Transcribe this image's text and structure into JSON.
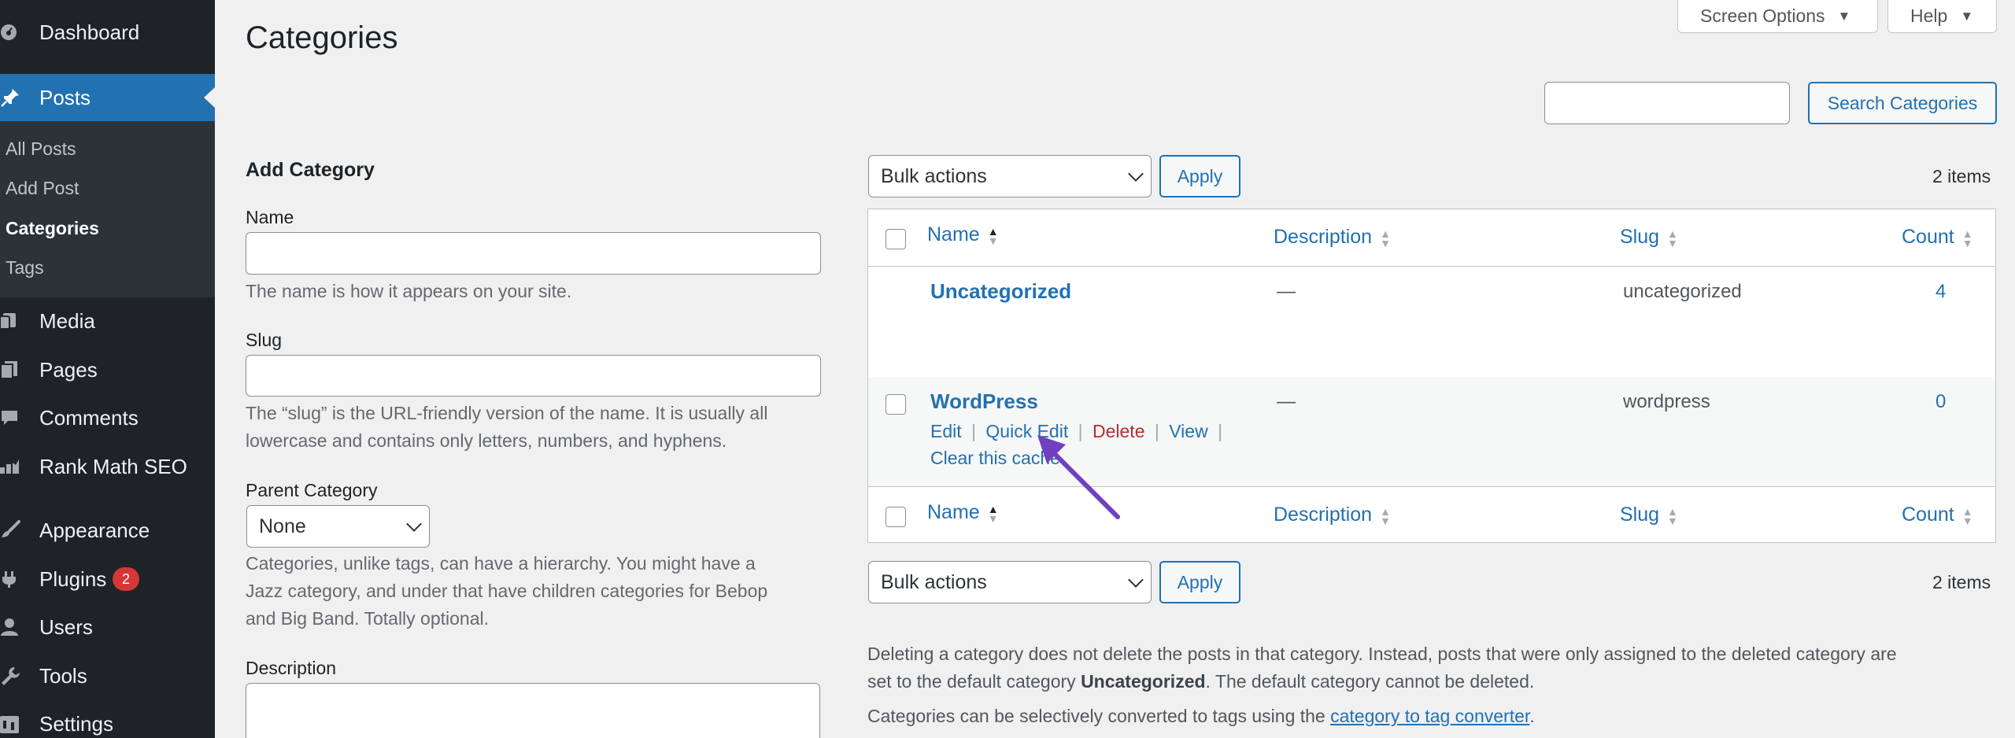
{
  "sidebar": {
    "dashboard": "Dashboard",
    "posts": "Posts",
    "submenu": [
      "All Posts",
      "Add Post",
      "Categories",
      "Tags"
    ],
    "media": "Media",
    "pages": "Pages",
    "comments": "Comments",
    "rankmath": "Rank Math SEO",
    "appearance": "Appearance",
    "plugins": "Plugins",
    "plugins_badge": "2",
    "users": "Users",
    "tools": "Tools",
    "settings": "Settings"
  },
  "top": {
    "screen_options": "Screen Options",
    "help": "Help"
  },
  "page_title": "Categories",
  "search": {
    "value": "",
    "button": "Search Categories"
  },
  "form": {
    "title": "Add Category",
    "name_label": "Name",
    "name_help": "The name is how it appears on your site.",
    "slug_label": "Slug",
    "slug_help_1": "The “slug” is the URL-friendly version of the name. It is usually all",
    "slug_help_2": "lowercase and contains only letters, numbers, and hyphens.",
    "parent_label": "Parent Category",
    "parent_value": "None",
    "parent_help_1": "Categories, unlike tags, can have a hierarchy. You might have a",
    "parent_help_2": "Jazz category, and under that have children categories for Bebop",
    "parent_help_3": "and Big Band. Totally optional.",
    "description_label": "Description"
  },
  "bulk": {
    "label": "Bulk actions",
    "apply": "Apply",
    "items": "2 items"
  },
  "table": {
    "columns": {
      "name": "Name",
      "description": "Description",
      "slug": "Slug",
      "count": "Count"
    },
    "rows": [
      {
        "name": "Uncategorized",
        "description": "—",
        "slug": "uncategorized",
        "count": "4"
      },
      {
        "name": "WordPress",
        "description": "—",
        "slug": "wordpress",
        "count": "0"
      }
    ],
    "actions": {
      "edit": "Edit",
      "quick_edit": "Quick Edit",
      "delete": "Delete",
      "view": "View",
      "clear_cache": "Clear this cache",
      "sep": "|"
    }
  },
  "notes": {
    "delete_1": "Deleting a category does not delete the posts in that category. Instead, posts that were only assigned to the deleted category are",
    "delete_2a": "set to the default category ",
    "delete_2b": "Uncategorized",
    "delete_2c": ". The default category cannot be deleted.",
    "convert_a": "Categories can be selectively converted to tags using the ",
    "convert_link": "category to tag converter",
    "convert_b": "."
  },
  "colors": {
    "accent": "#2271b1",
    "sidebar": "#1d2327",
    "annotation": "#7040c0",
    "delete": "#b32d2e"
  }
}
